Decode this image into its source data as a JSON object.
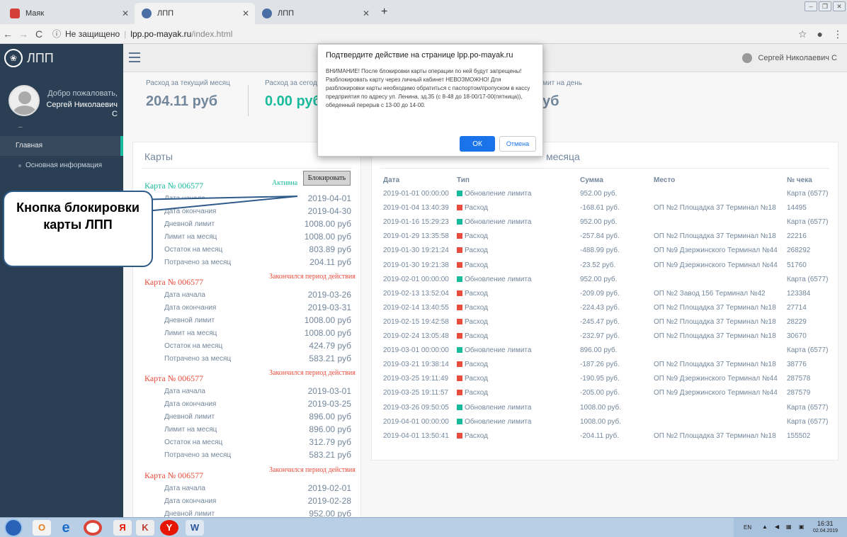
{
  "browser": {
    "tabs": [
      {
        "label": "Маяк",
        "color": "#d43f3a"
      },
      {
        "label": "ЛПП",
        "color": "#4a6fa5"
      },
      {
        "label": "ЛПП",
        "color": "#4a6fa5"
      }
    ],
    "new_tab": "+",
    "security": "Не защищено",
    "host": "lpp.po-mayak.ru",
    "path": "/index.html"
  },
  "sidebar": {
    "brand": "ЛПП",
    "welcome": "Добро пожаловать,",
    "user_name": "Сергей Николаевич С",
    "dash": "–",
    "menu": [
      {
        "label": "Главная"
      },
      {
        "label": "Основная информация"
      }
    ]
  },
  "topnav": {
    "user": "Сергей Николаевич С"
  },
  "stats": [
    {
      "label": "Расход за текущий месяц",
      "value": "204.11 руб"
    },
    {
      "label": "Расход за сегодня",
      "value": "0.00 руб"
    },
    {
      "label": "Лимит на день",
      "value": "руб"
    }
  ],
  "cards_panel": {
    "title": "Карты",
    "block_button": "Блокировать",
    "cards": [
      {
        "title": "Карта № 006577",
        "status": "Активна",
        "rows": [
          {
            "k": "Дата начала",
            "v": "2019-04-01"
          },
          {
            "k": "Дата окончания",
            "v": "2019-04-30"
          },
          {
            "k": "Дневной лимит",
            "v": "1008.00 руб"
          },
          {
            "k": "Лимит на месяц",
            "v": "1008.00 руб"
          },
          {
            "k": "Остаток на месяц",
            "v": "803.89 руб"
          },
          {
            "k": "Потрачено за месяц",
            "v": "204.11 руб"
          }
        ]
      },
      {
        "title": "Карта № 006577",
        "status": "Закончился период действия",
        "rows": [
          {
            "k": "Дата начала",
            "v": "2019-03-26"
          },
          {
            "k": "Дата окончания",
            "v": "2019-03-31"
          },
          {
            "k": "Дневной лимит",
            "v": "1008.00 руб"
          },
          {
            "k": "Лимит на месяц",
            "v": "1008.00 руб"
          },
          {
            "k": "Остаток на месяц",
            "v": "424.79 руб"
          },
          {
            "k": "Потрачено за месяц",
            "v": "583.21 руб"
          }
        ]
      },
      {
        "title": "Карта № 006577",
        "status": "Закончился период действия",
        "rows": [
          {
            "k": "Дата начала",
            "v": "2019-03-01"
          },
          {
            "k": "Дата окончания",
            "v": "2019-03-25"
          },
          {
            "k": "Дневной лимит",
            "v": "896.00 руб"
          },
          {
            "k": "Лимит на месяц",
            "v": "896.00 руб"
          },
          {
            "k": "Остаток на месяц",
            "v": "312.79 руб"
          },
          {
            "k": "Потрачено за месяц",
            "v": "583.21 руб"
          }
        ]
      },
      {
        "title": "Карта № 006577",
        "status": "Закончился период действия",
        "rows": [
          {
            "k": "Дата начала",
            "v": "2019-02-01"
          },
          {
            "k": "Дата окончания",
            "v": "2019-02-28"
          },
          {
            "k": "Дневной лимит",
            "v": "952.00 руб"
          }
        ]
      }
    ]
  },
  "tx_panel": {
    "title": "месяца",
    "headers": [
      "Дата",
      "Тип",
      "Сумма",
      "Место",
      "№ чека"
    ],
    "rows": [
      {
        "date": "2019-01-01 00:00:00",
        "type": "Обновление лимита",
        "kind": "limit",
        "sum": "952.00 руб.",
        "place": "",
        "check": "Карта (6577)"
      },
      {
        "date": "2019-01-04 13:40:39",
        "type": "Расход",
        "kind": "spend",
        "sum": "-168.61 руб.",
        "place": "ОП №2 Площадка 37 Терминал №18",
        "check": "14495"
      },
      {
        "date": "2019-01-16 15:29:23",
        "type": "Обновление лимита",
        "kind": "limit",
        "sum": "952.00 руб.",
        "place": "",
        "check": "Карта (6577)"
      },
      {
        "date": "2019-01-29 13:35:58",
        "type": "Расход",
        "kind": "spend",
        "sum": "-257.84 руб.",
        "place": "ОП №2 Площадка 37 Терминал №18",
        "check": "22216"
      },
      {
        "date": "2019-01-30 19:21:24",
        "type": "Расход",
        "kind": "spend",
        "sum": "-488.99 руб.",
        "place": "ОП №9 Дзержинского Терминал №44",
        "check": "268292"
      },
      {
        "date": "2019-01-30 19:21:38",
        "type": "Расход",
        "kind": "spend",
        "sum": "-23.52 руб.",
        "place": "ОП №9 Дзержинского Терминал №44",
        "check": "51760"
      },
      {
        "date": "2019-02-01 00:00:00",
        "type": "Обновление лимита",
        "kind": "limit",
        "sum": "952.00 руб.",
        "place": "",
        "check": "Карта (6577)"
      },
      {
        "date": "2019-02-13 13:52:04",
        "type": "Расход",
        "kind": "spend",
        "sum": "-209.09 руб.",
        "place": "ОП №2 Завод 156 Терминал №42",
        "check": "123384"
      },
      {
        "date": "2019-02-14 13:40:55",
        "type": "Расход",
        "kind": "spend",
        "sum": "-224.43 руб.",
        "place": "ОП №2 Площадка 37 Терминал №18",
        "check": "27714"
      },
      {
        "date": "2019-02-15 19:42:58",
        "type": "Расход",
        "kind": "spend",
        "sum": "-245.47 руб.",
        "place": "ОП №2 Площадка 37 Терминал №18",
        "check": "28229"
      },
      {
        "date": "2019-02-24 13:05:48",
        "type": "Расход",
        "kind": "spend",
        "sum": "-232.97 руб.",
        "place": "ОП №2 Площадка 37 Терминал №18",
        "check": "30670"
      },
      {
        "date": "2019-03-01 00:00:00",
        "type": "Обновление лимита",
        "kind": "limit",
        "sum": "896.00 руб.",
        "place": "",
        "check": "Карта (6577)"
      },
      {
        "date": "2019-03-21 19:38:14",
        "type": "Расход",
        "kind": "spend",
        "sum": "-187.26 руб.",
        "place": "ОП №2 Площадка 37 Терминал №18",
        "check": "38776"
      },
      {
        "date": "2019-03-25 19:11:49",
        "type": "Расход",
        "kind": "spend",
        "sum": "-190.95 руб.",
        "place": "ОП №9 Дзержинского Терминал №44",
        "check": "287578"
      },
      {
        "date": "2019-03-25 19:11:57",
        "type": "Расход",
        "kind": "spend",
        "sum": "-205.00 руб.",
        "place": "ОП №9 Дзержинского Терминал №44",
        "check": "287579"
      },
      {
        "date": "2019-03-26 09:50:05",
        "type": "Обновление лимита",
        "kind": "limit",
        "sum": "1008.00 руб.",
        "place": "",
        "check": "Карта (6577)"
      },
      {
        "date": "2019-04-01 00:00:00",
        "type": "Обновление лимита",
        "kind": "limit",
        "sum": "1008.00 руб.",
        "place": "",
        "check": "Карта (6577)"
      },
      {
        "date": "2019-04-01 13:50:41",
        "type": "Расход",
        "kind": "spend",
        "sum": "-204.11 руб.",
        "place": "ОП №2 Площадка 37 Терминал №18",
        "check": "155502"
      }
    ]
  },
  "dialog": {
    "title": "Подтвердите действие на странице lpp.po-mayak.ru",
    "text": "ВНИМАНИЕ! После блокировки карты операции по ней будут запрещены! Разблокировать карту через личный кабинет НЕВОЗМОЖНО! Для разблокировки карты необходимо обратиться с паспортом/пропуском в кассу предприятия по адресу ул. Ленина, зд.35 (с 8-48 до 18-00/17-00(пятница)), обеденный перерыв с 13-00 до 14-00.",
    "ok": "ОК",
    "cancel": "Отмена"
  },
  "callout": {
    "text": "Кнопка блокировки карты ЛПП"
  },
  "taskbar": {
    "lang": "EN",
    "time": "16:31",
    "date": "02.04.2019"
  },
  "colors": {
    "accent": "#1abb9c",
    "danger": "#e74c3c",
    "sidebar": "#2a3f54",
    "dialog_button": "#1a73e8"
  }
}
